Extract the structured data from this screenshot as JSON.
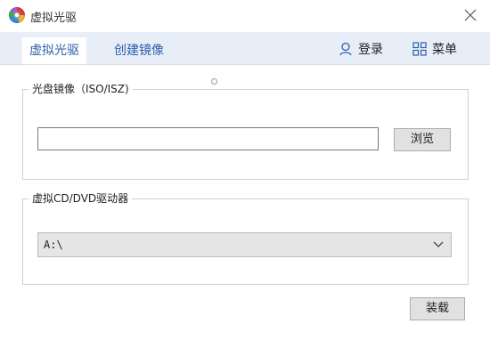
{
  "window": {
    "title": "虚拟光驱"
  },
  "tabs": [
    {
      "label": "虚拟光驱",
      "active": true
    },
    {
      "label": "创建镜像",
      "active": false
    }
  ],
  "header_actions": {
    "login_label": "登录",
    "menu_label": "菜单",
    "login_icon": "user-icon",
    "menu_icon": "grid-icon"
  },
  "image_group": {
    "title": "光盘镜像（ISO/ISZ)",
    "path_value": "",
    "browse_label": "浏览"
  },
  "drive_group": {
    "title": "虚拟CD/DVD驱动器",
    "selected_drive": "A:\\"
  },
  "footer": {
    "mount_label": "装载"
  },
  "colors": {
    "tab_bar_bg": "#e7eef8",
    "accent_text": "#2c5fa8",
    "button_bg": "#e1e1e1"
  }
}
